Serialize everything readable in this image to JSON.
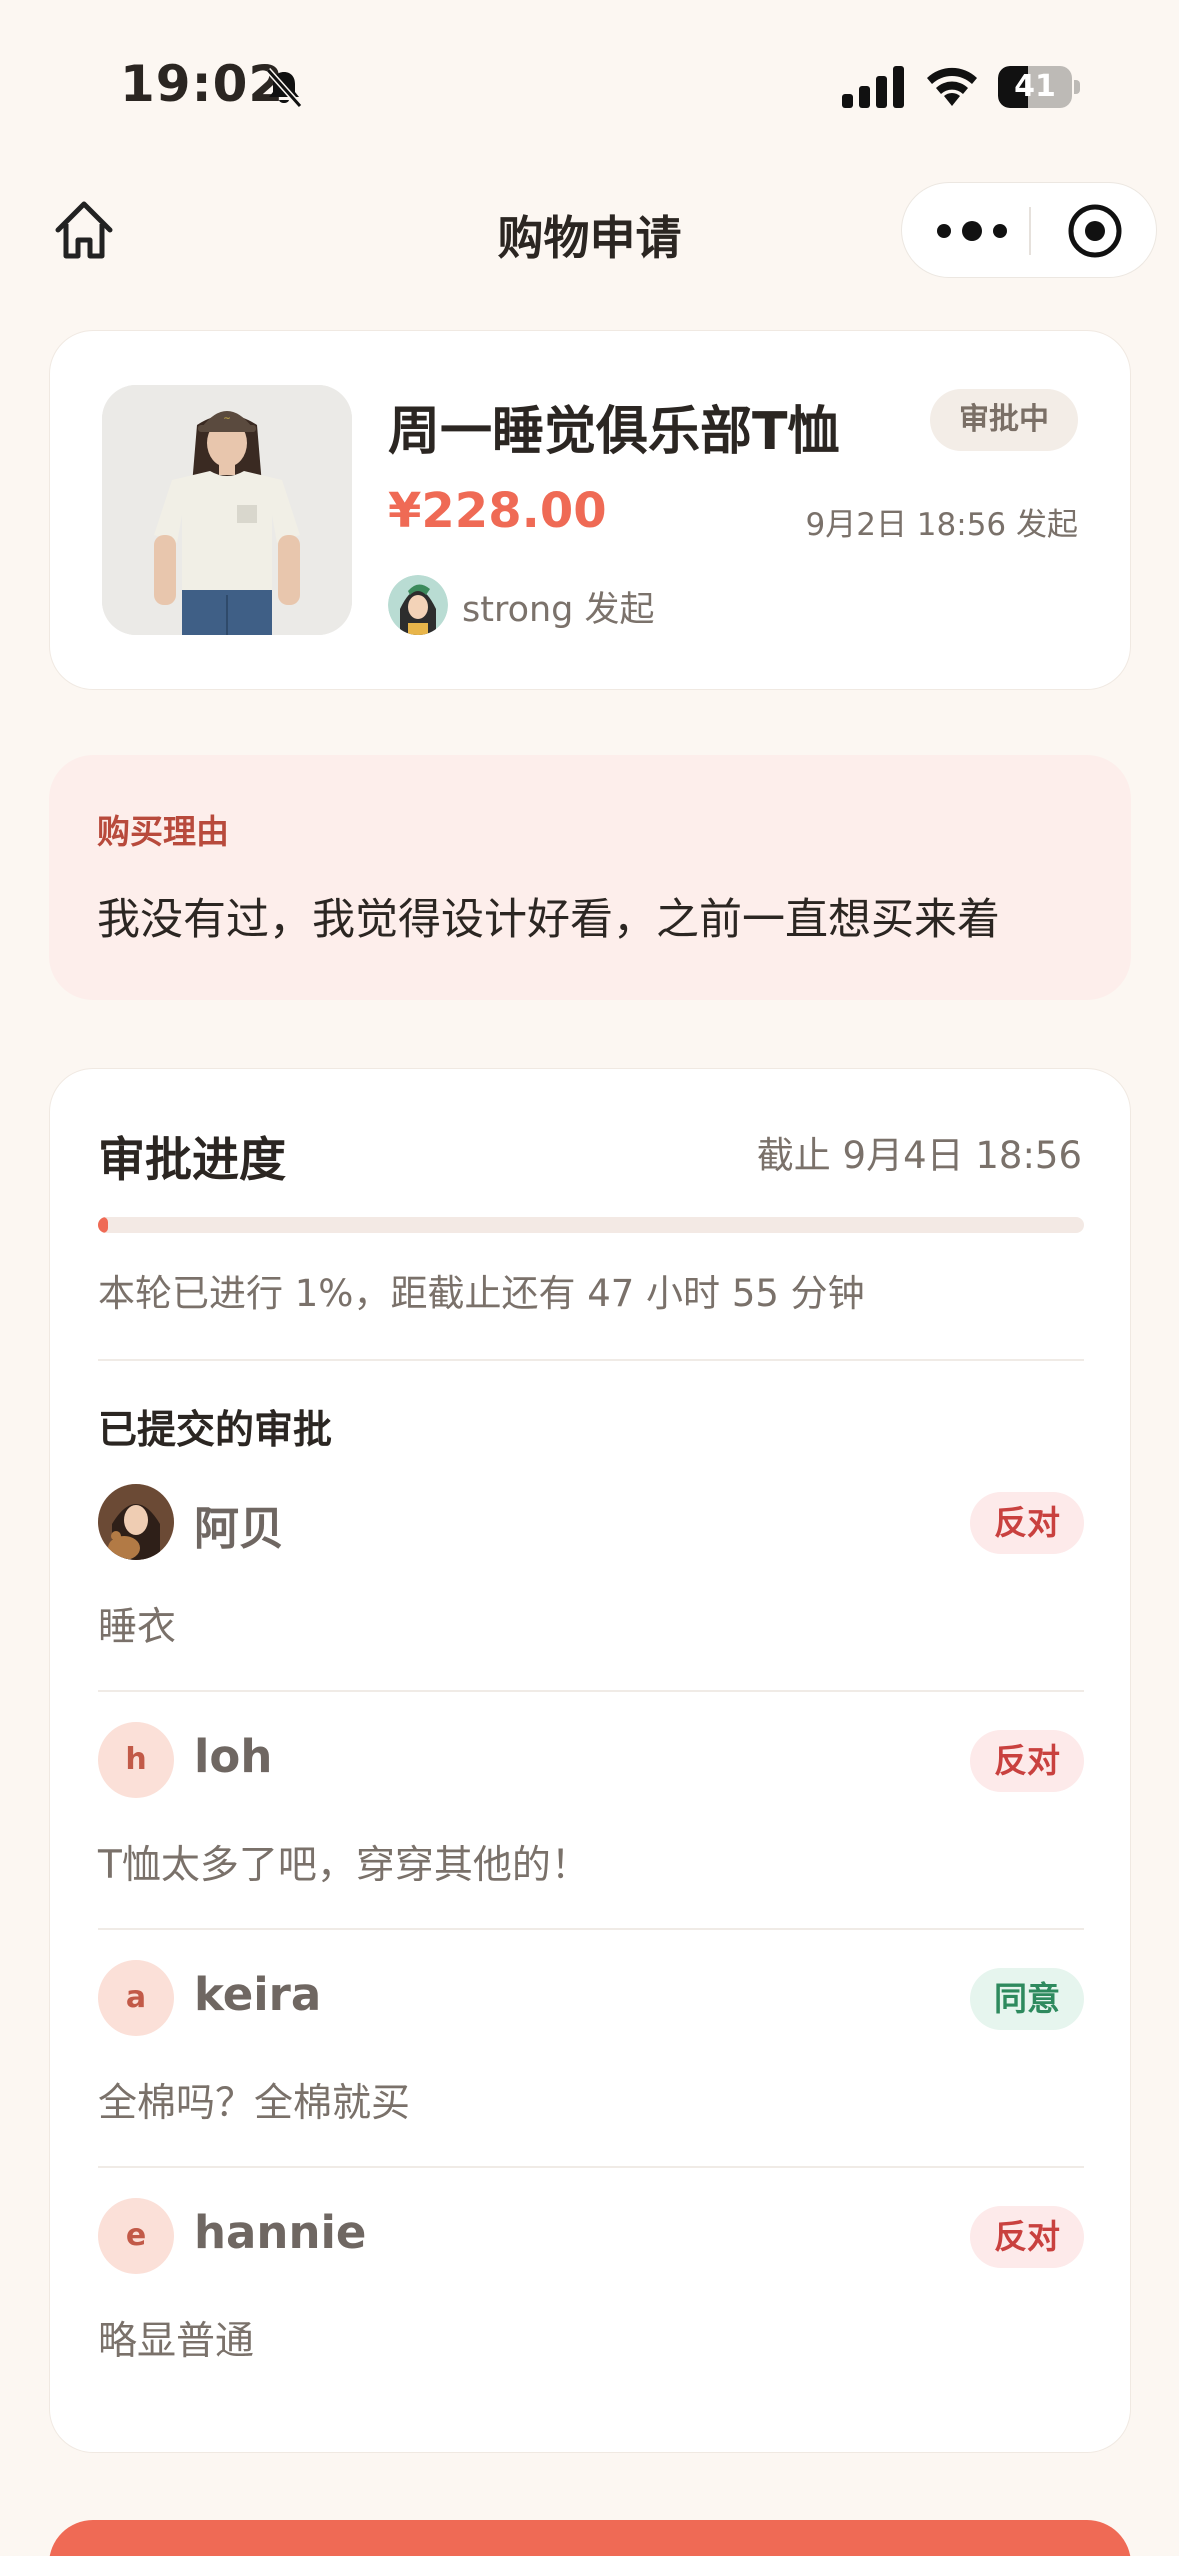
{
  "status_bar": {
    "time": "19:02",
    "battery": "41",
    "battery_level": 0.41
  },
  "nav": {
    "title": "购物申请"
  },
  "product": {
    "name": "周一睡觉俱乐部T恤",
    "status": "审批中",
    "price": "¥228.00",
    "start_time": "9月2日 18:56 发起",
    "initiator": "strong 发起"
  },
  "reason": {
    "label": "购买理由",
    "text": "我没有过，我觉得设计好看，之前一直想买来着"
  },
  "progress": {
    "title": "审批进度",
    "deadline": "截止 9月4日 18:56",
    "percent": 1,
    "note": "本轮已进行 1%，距截止还有 47 小时 55 分钟",
    "submitted_title": "已提交的审批"
  },
  "reviews": [
    {
      "avatar": "",
      "name": "阿贝",
      "decision": "反对",
      "comment": "睡衣"
    },
    {
      "avatar": "h",
      "name": "loh",
      "decision": "反对",
      "comment": "T恤太多了吧，穿穿其他的！"
    },
    {
      "avatar": "a",
      "name": "keira",
      "decision": "同意",
      "comment": "全棉吗？全棉就买"
    },
    {
      "avatar": "e",
      "name": "hannie",
      "decision": "反对",
      "comment": "略显普通"
    }
  ],
  "colors": {
    "accent": "#ef6a55",
    "background": "#fcf7f2",
    "oppose": "#c9413f",
    "agree": "#2e8a5e"
  }
}
